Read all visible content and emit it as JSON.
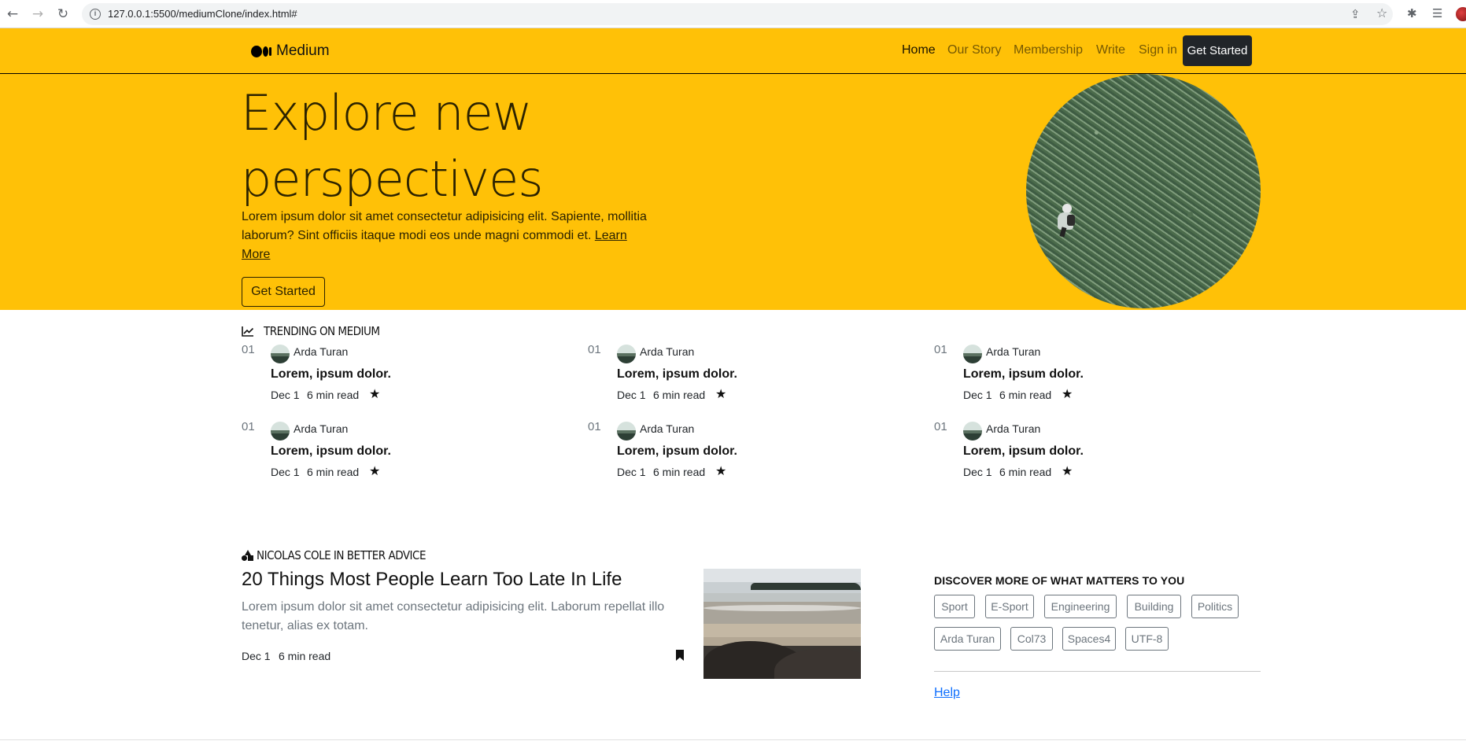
{
  "browser": {
    "url": "127.0.0.1:5500/mediumClone/index.html#"
  },
  "nav": {
    "brand": "Medium",
    "links": [
      "Home",
      "Our Story",
      "Membership",
      "Write",
      "Sign in"
    ],
    "cta": "Get Started"
  },
  "hero": {
    "title_line1": "Explore new",
    "title_line2": "perspectives",
    "text": "Lorem ipsum dolor sit amet consectetur adipisicing elit. Sapiente, mollitia laborum? Sint officiis itaque modi eos unde magni commodi et.",
    "learn_more": "Learn More",
    "button": "Get Started"
  },
  "trending": {
    "title": "TRENDING ON MEDIUM",
    "items": [
      {
        "num": "01",
        "author": "Arda Turan",
        "title": "Lorem, ipsum dolor.",
        "date": "Dec 1",
        "read": "6 min read"
      },
      {
        "num": "01",
        "author": "Arda Turan",
        "title": "Lorem, ipsum dolor.",
        "date": "Dec 1",
        "read": "6 min read"
      },
      {
        "num": "01",
        "author": "Arda Turan",
        "title": "Lorem, ipsum dolor.",
        "date": "Dec 1",
        "read": "6 min read"
      },
      {
        "num": "01",
        "author": "Arda Turan",
        "title": "Lorem, ipsum dolor.",
        "date": "Dec 1",
        "read": "6 min read"
      },
      {
        "num": "01",
        "author": "Arda Turan",
        "title": "Lorem, ipsum dolor.",
        "date": "Dec 1",
        "read": "6 min read"
      },
      {
        "num": "01",
        "author": "Arda Turan",
        "title": "Lorem, ipsum dolor.",
        "date": "Dec 1",
        "read": "6 min read"
      }
    ]
  },
  "post": {
    "author": "NICOLAS COLE IN BETTER ADVICE",
    "title": "20 Things Most People Learn Too Late In Life",
    "excerpt": "Lorem ipsum dolor sit amet consectetur adipisicing elit. Laborum repellat illo tenetur, alias ex totam.",
    "date": "Dec 1",
    "read": "6 min read"
  },
  "discover": {
    "title": "DISCOVER MORE OF WHAT MATTERS TO YOU",
    "tags": [
      "Sport",
      "E-Sport",
      "Engineering",
      "Building",
      "Politics",
      "Arda Turan",
      "Col73",
      "Spaces4",
      "UTF-8"
    ],
    "help": "Help"
  },
  "icons": {
    "back": "arrow-left-icon",
    "forward": "arrow-right-icon",
    "reload": "reload-icon",
    "trend": "chart-line-icon",
    "star": "star-icon",
    "bookmark": "bookmark-icon",
    "shapes": "shapes-icon"
  },
  "colors": {
    "brand_yellow": "#ffc107",
    "dark": "#212529",
    "muted": "#6c757d",
    "link": "#0d6efd"
  }
}
